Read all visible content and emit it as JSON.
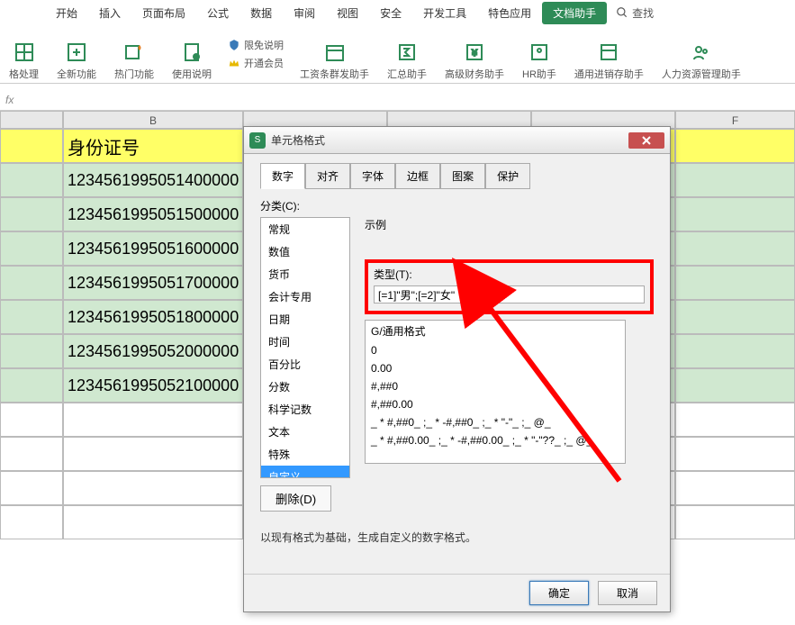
{
  "ribbon": {
    "tabs": [
      "开始",
      "插入",
      "页面布局",
      "公式",
      "数据",
      "审阅",
      "视图",
      "安全",
      "开发工具",
      "特色应用",
      "文档助手"
    ],
    "active_index": 10,
    "search_label": "查找",
    "groups": [
      {
        "label": "格处理"
      },
      {
        "label": "全新功能"
      },
      {
        "label": "热门功能"
      },
      {
        "label": "使用说明"
      }
    ],
    "small_items": [
      {
        "icon": "shield-icon",
        "label": "限免说明"
      },
      {
        "icon": "crown-icon",
        "label": "开通会员"
      }
    ],
    "assistants": [
      "工资条群发助手",
      "汇总助手",
      "高级财务助手",
      "HR助手",
      "通用进销存助手",
      "人力资源管理助手"
    ]
  },
  "fx_label": "fx",
  "columns": [
    "B",
    "F"
  ],
  "col_A_blank": "",
  "sheet": {
    "header_B": "身份证号",
    "rows": [
      "1234561995051400000",
      "1234561995051500000",
      "1234561995051600000",
      "1234561995051700000",
      "1234561995051800000",
      "1234561995052000000",
      "1234561995052100000"
    ]
  },
  "dialog": {
    "title": "单元格格式",
    "tabs": [
      "数字",
      "对齐",
      "字体",
      "边框",
      "图案",
      "保护"
    ],
    "active_tab": 0,
    "category_label": "分类(C):",
    "categories": [
      "常规",
      "数值",
      "货币",
      "会计专用",
      "日期",
      "时间",
      "百分比",
      "分数",
      "科学记数",
      "文本",
      "特殊",
      "自定义"
    ],
    "selected_category": 11,
    "example_label": "示例",
    "type_label": "类型(T):",
    "type_value": "[=1]\"男\";[=2]\"女\"",
    "format_list": [
      "G/通用格式",
      "0",
      "0.00",
      "#,##0",
      "#,##0.00",
      "_ * #,##0_ ;_ * -#,##0_ ;_ * \"-\"_ ;_ @_",
      "_ * #,##0.00_ ;_ * -#,##0.00_ ;_ * \"-\"??_ ;_ @_"
    ],
    "delete_btn": "删除(D)",
    "hint": "以现有格式为基础，生成自定义的数字格式。",
    "ok": "确定",
    "cancel": "取消"
  }
}
